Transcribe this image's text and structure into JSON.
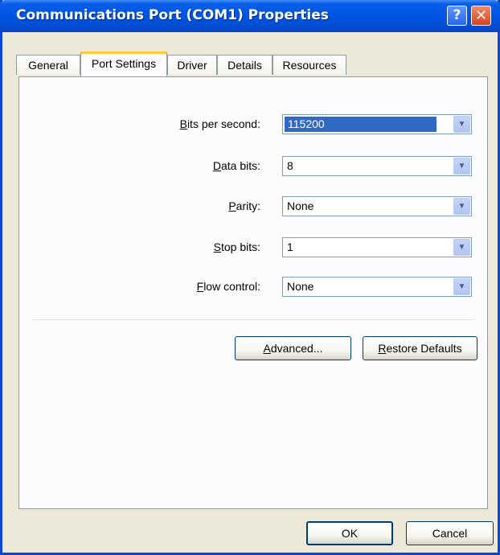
{
  "window": {
    "title": "Communications Port (COM1) Properties",
    "help_label": "?",
    "close_label": "✕"
  },
  "tabs": [
    {
      "label": "General",
      "active": false
    },
    {
      "label": "Port Settings",
      "active": true
    },
    {
      "label": "Driver",
      "active": false
    },
    {
      "label": "Details",
      "active": false
    },
    {
      "label": "Resources",
      "active": false
    }
  ],
  "settings": {
    "bits_per_second": {
      "label_access": "B",
      "label_rest": "its per second:",
      "value": "115200"
    },
    "data_bits": {
      "label_access": "D",
      "label_rest": "ata bits:",
      "value": "8"
    },
    "parity": {
      "label_access": "P",
      "label_rest": "arity:",
      "value": "None"
    },
    "stop_bits": {
      "label_access": "S",
      "label_rest": "top bits:",
      "value": "1"
    },
    "flow_control": {
      "label_access": "F",
      "label_rest": "low control:",
      "value": "None"
    }
  },
  "buttons": {
    "advanced": {
      "label_access": "A",
      "label_rest": "dvanced..."
    },
    "restore_defaults": {
      "label_access": "R",
      "label_rest": "estore Defaults"
    },
    "ok": "OK",
    "cancel": "Cancel"
  },
  "colors": {
    "titlebar": "#0057e5",
    "selection": "#316ac5",
    "dialog_bg": "#ece9d8",
    "active_tab_accent": "#ffc83c"
  }
}
